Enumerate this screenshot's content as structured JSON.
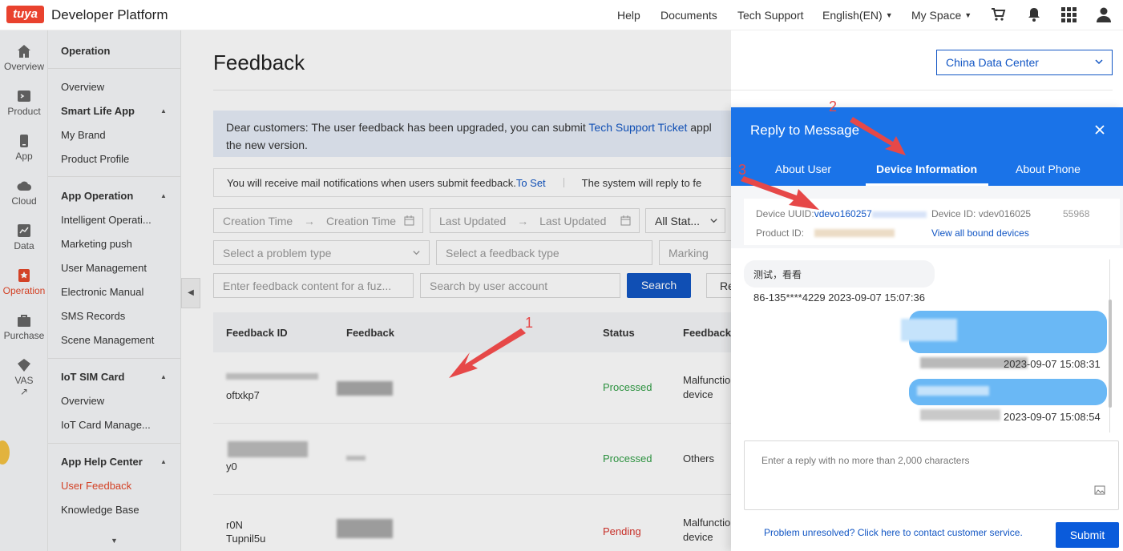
{
  "topbar": {
    "logo": "tuya",
    "brand": "Developer Platform",
    "nav": [
      "Help",
      "Documents",
      "Tech Support",
      "English(EN)",
      "My Space"
    ],
    "icons": [
      "cart-icon",
      "bell-icon",
      "apps-grid-icon",
      "user-icon"
    ]
  },
  "rail": {
    "items": [
      {
        "label": "Overview",
        "icon": "home-icon"
      },
      {
        "label": "Product",
        "icon": "product-icon"
      },
      {
        "label": "App",
        "icon": "app-icon"
      },
      {
        "label": "Cloud",
        "icon": "cloud-icon"
      },
      {
        "label": "Data",
        "icon": "data-icon"
      },
      {
        "label": "Operation",
        "icon": "operation-icon",
        "active": true
      },
      {
        "label": "Purchase",
        "icon": "purchase-icon"
      },
      {
        "label": "VAS",
        "icon": "vas-icon"
      }
    ],
    "accent": "#e5482a"
  },
  "menu": {
    "title": "Operation",
    "items": [
      "Overview",
      "Smart Life App",
      "My Brand",
      "Product Profile",
      "App Operation",
      "Intelligent Operati...",
      "Marketing push",
      "User Management",
      "Electronic Manual",
      "SMS Records",
      "Scene Management",
      "IoT SIM Card",
      "Overview",
      "IoT Card Manage...",
      "App Help Center",
      "User Feedback",
      "Knowledge Base"
    ]
  },
  "main": {
    "title": "Feedback",
    "data_center": "China Data Center",
    "notice_1": "Dear customers: The user feedback has been upgraded, you can submit ",
    "notice_link": "Tech Support Ticket",
    "notice_2": " appl",
    "notice_3": "the new version.",
    "mail_1": "You will receive mail notifications when users submit feedback.",
    "mail_link": "To Set",
    "mail_2": "The system will reply to fe",
    "filters": {
      "creation_start": "Creation Time",
      "creation_end": "Creation Time",
      "updated_start": "Last Updated",
      "updated_end": "Last Updated",
      "status": "All Stat...",
      "problem_type": "Select a problem type",
      "feedback_type": "Select a feedback type",
      "marking": "Marking",
      "content_placeholder": "Enter feedback content for a fuz...",
      "account_placeholder": "Search by user account",
      "search": "Search",
      "reset": "Re"
    },
    "table": {
      "headers": [
        "Feedback ID",
        "Feedback",
        "Status",
        "Feedback"
      ],
      "rows": [
        {
          "id": "oftxkp7",
          "status": "Processed",
          "status_color": "#2f9e44",
          "type_1": "Malfunctio",
          "type_2": "device"
        },
        {
          "id": "y0",
          "status": "Processed",
          "status_color": "#2f9e44",
          "type_1": "Others",
          "type_2": ""
        },
        {
          "id": "r0N",
          "id_2": "Tupnil5u",
          "status": "Pending",
          "status_color": "#d8342c",
          "type_1": "Malfunctio",
          "type_2": "device"
        }
      ]
    }
  },
  "panel": {
    "title": "Reply to Message",
    "tabs": [
      "About User",
      "Device Information",
      "About Phone"
    ],
    "device_uuid_label": "Device UUID:",
    "device_uuid_value": "vdevo160257",
    "device_id_label": "Device ID:",
    "device_id_value": "vdev016025",
    "device_id_tail": "55968",
    "product_id_label": "Product ID:",
    "view_all": "View all bound devices",
    "messages": [
      {
        "text": "测试，看看",
        "meta": "86-135****4229 2023-09-07 15:07:36"
      },
      {
        "meta": "2023-09-07 15:08:31"
      },
      {
        "meta": "2023-09-07 15:08:54"
      }
    ],
    "reply_placeholder": "Enter a reply with no more than 2,000 characters",
    "help_link": "Problem unresolved? Click here to contact customer service.",
    "submit": "Submit"
  },
  "annotations": [
    "1",
    "2",
    "3"
  ],
  "colors": {
    "primary": "#1256c4",
    "panel_header": "#1a73e8",
    "arrow": "#e64848"
  }
}
